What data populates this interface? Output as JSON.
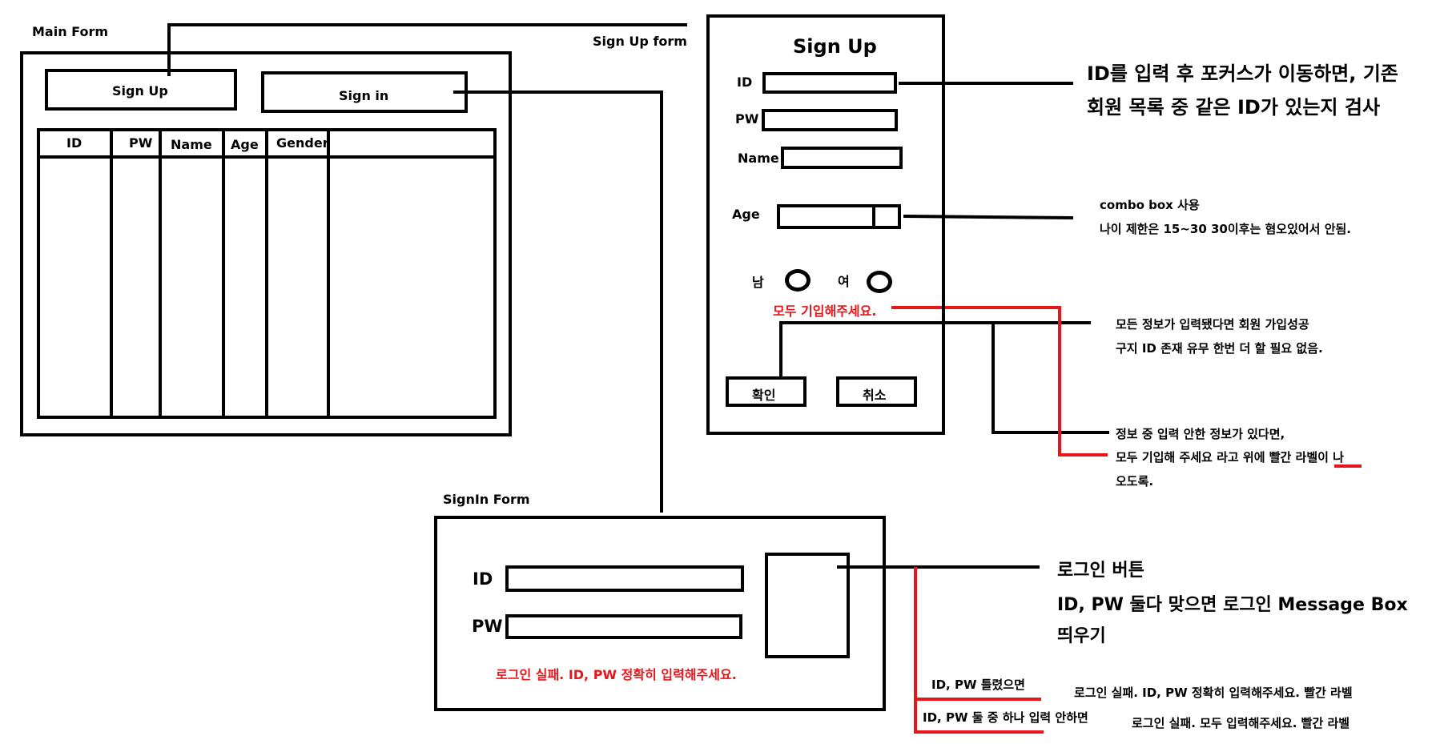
{
  "main_form": {
    "title": "Main Form",
    "signup_button": "Sign Up",
    "signin_button": "Sign in",
    "table_headers": [
      "ID",
      "PW",
      "Name",
      "Age",
      "Gender"
    ]
  },
  "signup_form": {
    "caption": "Sign Up form",
    "title": "Sign Up",
    "id_label": "ID",
    "pw_label": "PW",
    "name_label": "Name",
    "age_label": "Age",
    "male_label": "남",
    "female_label": "여",
    "error_text": "모두 기입해주세요.",
    "ok_button": "확인",
    "cancel_button": "취소"
  },
  "signin_form": {
    "title": "SignIn Form",
    "id_label": "ID",
    "pw_label": "PW",
    "error_text": "로그인 실패. ID, PW 정확히 입력해주세요."
  },
  "notes": {
    "id_check_line1": "ID를 입력 후 포커스가 이동하면, 기존",
    "id_check_line2": "회원 목록 중 같은 ID가 있는지 검사",
    "combo_line1": "combo box 사용",
    "combo_line2": "나이 제한은 15~30 30이후는 혐오있어서 안됨.",
    "success_line1": "모든 정보가 입력됐다면 회원 가입성공",
    "success_line2": "구지 ID 존재 유무 한번 더 할 필요 없음.",
    "missing_line1": "정보 중 입력 안한 정보가 있다면,",
    "missing_line2": "모두 기입해 주세요 라고 위에 빨간 라벨이 나",
    "missing_line3": "오도록.",
    "login_line1": "로그인 버튼",
    "login_line2": "ID, PW 둘다 맞으면 로그인 Message Box",
    "login_line3": "띄우기",
    "wrong_case": "ID, PW 틀렸으면",
    "wrong_result": "로그인 실패. ID, PW 정확히 입력해주세요. 빨간 라벨",
    "missing_case": "ID, PW 둘 중 하나 입력 안하면",
    "missing_result": "로그인 실패. 모두 입력해주세요. 빨간 라벨"
  },
  "colors": {
    "line": "#000000",
    "accent_red": "#e8161b"
  }
}
